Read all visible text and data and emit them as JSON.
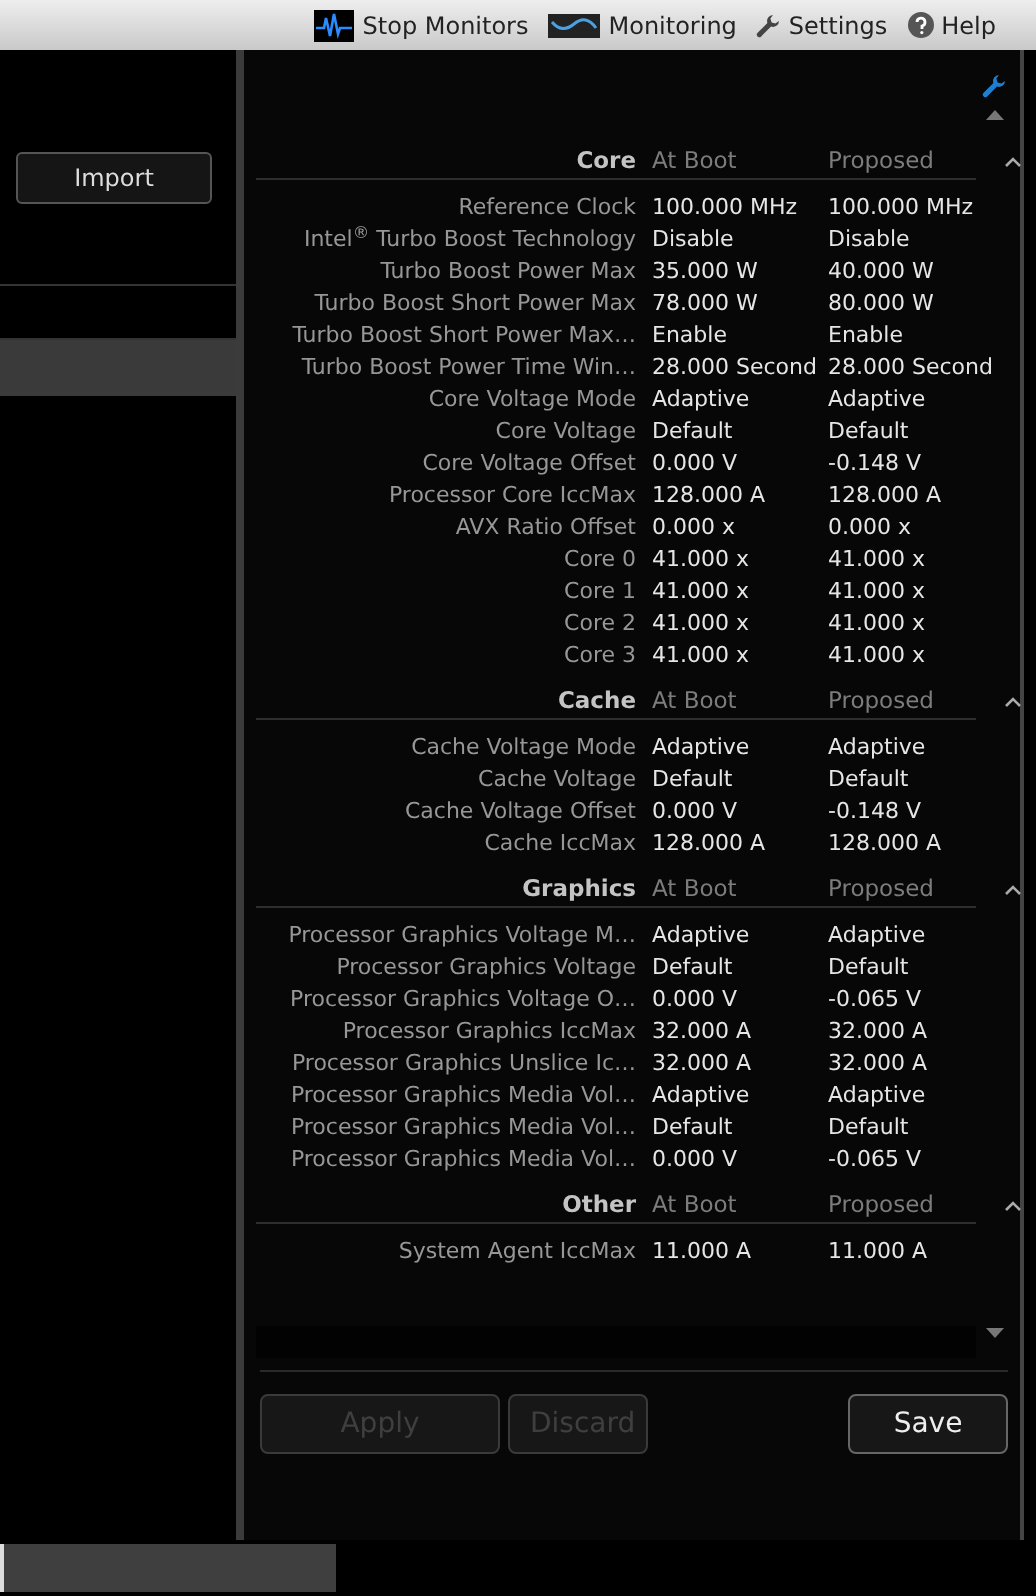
{
  "toolbar": [
    {
      "label": "Stop Monitors",
      "kind": "wave"
    },
    {
      "label": "Monitoring",
      "kind": "chart"
    },
    {
      "label": "Settings",
      "kind": "wrench"
    },
    {
      "label": "Help",
      "kind": "help"
    }
  ],
  "left_panel": {
    "import_button": "Import"
  },
  "sections": [
    {
      "title": "Core",
      "column_1": "At Boot",
      "column_2": "Proposed",
      "expanded": true,
      "rows": [
        {
          "name": "Reference Clock",
          "at_boot": "100.000 MHz",
          "proposed": "100.000 MHz"
        },
        {
          "name": "Intel$^{®}$ Turbo Boost Technology",
          "at_boot": "Disable",
          "proposed": "Disable"
        },
        {
          "name": "Turbo Boost Power Max",
          "at_boot": "35.000 W",
          "proposed": "40.000 W"
        },
        {
          "name": "Turbo Boost Short Power Max",
          "at_boot": "78.000 W",
          "proposed": "80.000 W"
        },
        {
          "name": "Turbo Boost Short Power Max…",
          "at_boot": "Enable",
          "proposed": "Enable"
        },
        {
          "name": "Turbo Boost Power Time Win…",
          "at_boot": "28.000 Second",
          "proposed": "28.000 Second"
        },
        {
          "name": "Core Voltage Mode",
          "at_boot": "Adaptive",
          "proposed": "Adaptive"
        },
        {
          "name": "Core Voltage",
          "at_boot": "Default",
          "proposed": "Default"
        },
        {
          "name": "Core Voltage Offset",
          "at_boot": "0.000 V",
          "proposed": "-0.148 V"
        },
        {
          "name": "Processor Core IccMax",
          "at_boot": "128.000 A",
          "proposed": "128.000 A"
        },
        {
          "name": "AVX Ratio Offset",
          "at_boot": "0.000 x",
          "proposed": "0.000 x"
        },
        {
          "name": "Core 0",
          "at_boot": "41.000 x",
          "proposed": "41.000 x"
        },
        {
          "name": "Core 1",
          "at_boot": "41.000 x",
          "proposed": "41.000 x"
        },
        {
          "name": "Core 2",
          "at_boot": "41.000 x",
          "proposed": "41.000 x"
        },
        {
          "name": "Core 3",
          "at_boot": "41.000 x",
          "proposed": "41.000 x"
        }
      ]
    },
    {
      "title": "Cache",
      "column_1": "At Boot",
      "column_2": "Proposed",
      "expanded": true,
      "rows": [
        {
          "name": "Cache Voltage Mode",
          "at_boot": "Adaptive",
          "proposed": "Adaptive"
        },
        {
          "name": "Cache Voltage",
          "at_boot": "Default",
          "proposed": "Default"
        },
        {
          "name": "Cache Voltage Offset",
          "at_boot": "0.000 V",
          "proposed": "-0.148 V"
        },
        {
          "name": "Cache IccMax",
          "at_boot": "128.000 A",
          "proposed": "128.000 A"
        }
      ]
    },
    {
      "title": "Graphics",
      "column_1": "At Boot",
      "column_2": "Proposed",
      "expanded": true,
      "rows": [
        {
          "name": "Processor Graphics Voltage M…",
          "at_boot": "Adaptive",
          "proposed": "Adaptive"
        },
        {
          "name": "Processor Graphics Voltage",
          "at_boot": "Default",
          "proposed": "Default"
        },
        {
          "name": "Processor Graphics Voltage O…",
          "at_boot": "0.000 V",
          "proposed": "-0.065 V"
        },
        {
          "name": "Processor Graphics IccMax",
          "at_boot": "32.000 A",
          "proposed": "32.000 A"
        },
        {
          "name": "Processor Graphics Unslice Ic…",
          "at_boot": "32.000 A",
          "proposed": "32.000 A"
        },
        {
          "name": "Processor Graphics Media Vol…",
          "at_boot": "Adaptive",
          "proposed": "Adaptive"
        },
        {
          "name": "Processor Graphics Media Vol…",
          "at_boot": "Default",
          "proposed": "Default"
        },
        {
          "name": "Processor Graphics Media Vol…",
          "at_boot": "0.000 V",
          "proposed": "-0.065 V"
        }
      ]
    },
    {
      "title": "Other",
      "column_1": "At Boot",
      "column_2": "Proposed",
      "expanded": true,
      "rows": [
        {
          "name": "System Agent IccMax",
          "at_boot": "11.000 A",
          "proposed": "11.000 A"
        }
      ]
    }
  ],
  "buttons": [
    {
      "label": "Apply",
      "disabled": true
    },
    {
      "label": "Discard",
      "disabled": true
    },
    {
      "label": "Save",
      "disabled": false
    }
  ]
}
